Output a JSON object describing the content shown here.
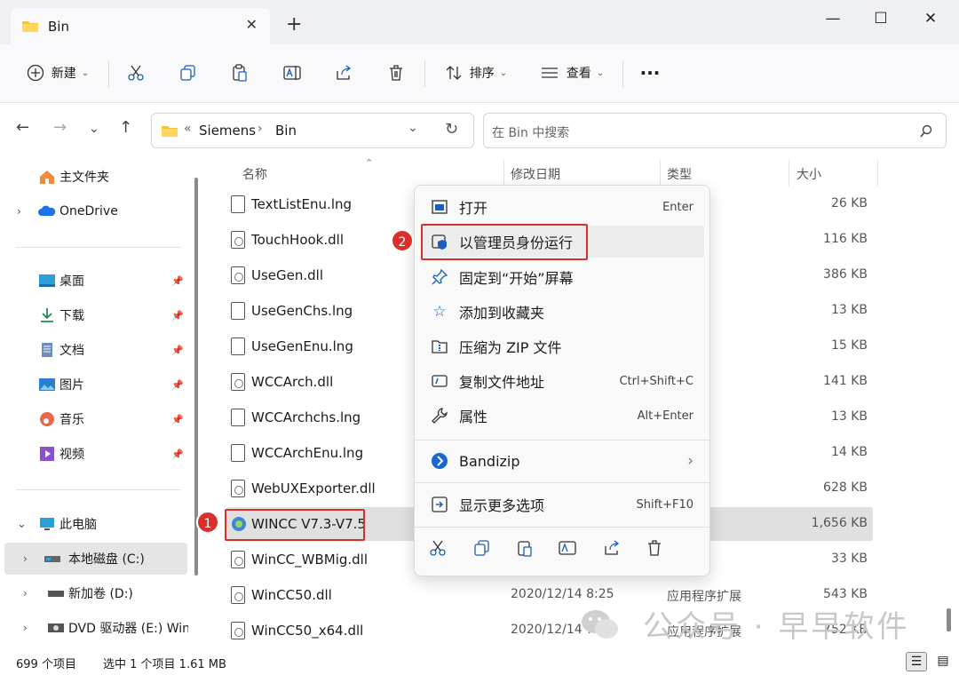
{
  "window": {
    "tab_title": "Bin",
    "close_tab": "✕",
    "new_tab": "+",
    "minimize": "—",
    "maximize": "☐",
    "close": "✕"
  },
  "toolbar": {
    "new_label": "新建",
    "sort_label": "排序",
    "view_label": "查看",
    "more_label": "···"
  },
  "navigation": {
    "breadcrumb_prefix": "«",
    "crumb_1": "Siemens",
    "crumb_sep": "›",
    "crumb_2": "Bin",
    "search_placeholder": "在 Bin 中搜索"
  },
  "sidebar": {
    "home": "主文件夹",
    "onedrive": "OneDrive",
    "desktop": "桌面",
    "downloads": "下载",
    "documents": "文档",
    "pictures": "图片",
    "music": "音乐",
    "videos": "视频",
    "this_pc": "此电脑",
    "drive_c": "本地磁盘 (C:)",
    "drive_d": "新加卷 (D:)",
    "drive_e": "DVD 驱动器 (E:) Win"
  },
  "columns": {
    "name": "名称",
    "date": "修改日期",
    "type": "类型",
    "size": "大小"
  },
  "files": [
    {
      "name": "TextListEnu.lng",
      "date": "",
      "type": "件",
      "size": "26 KB",
      "icon": "file"
    },
    {
      "name": "TouchHook.dll",
      "date": "",
      "type": "序扩展",
      "size": "116 KB",
      "icon": "dll"
    },
    {
      "name": "UseGen.dll",
      "date": "",
      "type": "序扩展",
      "size": "386 KB",
      "icon": "dll"
    },
    {
      "name": "UseGenChs.lng",
      "date": "",
      "type": "件",
      "size": "13 KB",
      "icon": "file"
    },
    {
      "name": "UseGenEnu.lng",
      "date": "",
      "type": "件",
      "size": "15 KB",
      "icon": "file"
    },
    {
      "name": "WCCArch.dll",
      "date": "",
      "type": "序扩展",
      "size": "141 KB",
      "icon": "dll"
    },
    {
      "name": "WCCArchchs.lng",
      "date": "",
      "type": "件",
      "size": "13 KB",
      "icon": "file"
    },
    {
      "name": "WCCArchEnu.lng",
      "date": "",
      "type": "件",
      "size": "14 KB",
      "icon": "file"
    },
    {
      "name": "WebUXExporter.dll",
      "date": "",
      "type": "序扩展",
      "size": "628 KB",
      "icon": "dll"
    },
    {
      "name": "WINCC V7.3-V7.5",
      "date": "",
      "type": "序",
      "size": "1,656 KB",
      "icon": "app"
    },
    {
      "name": "WinCC_WBMig.dll",
      "date": "",
      "type": "序扩展",
      "size": "33 KB",
      "icon": "dll"
    },
    {
      "name": "WinCC50.dll",
      "date": "2020/12/14 8:25",
      "type": "应用程序扩展",
      "size": "543 KB",
      "icon": "dll"
    },
    {
      "name": "WinCC50_x64.dll",
      "date": "2020/12/14 7:49",
      "type": "应用程序扩展",
      "size": "752 KB",
      "icon": "dll"
    }
  ],
  "context_menu": {
    "open": "打开",
    "open_shortcut": "Enter",
    "run_as_admin": "以管理员身份运行",
    "pin_start": "固定到“开始”屏幕",
    "add_favorites": "添加到收藏夹",
    "compress_zip": "压缩为 ZIP 文件",
    "copy_path": "复制文件地址",
    "copy_path_shortcut": "Ctrl+Shift+C",
    "properties": "属性",
    "properties_shortcut": "Alt+Enter",
    "bandizip": "Bandizip",
    "more_options": "显示更多选项",
    "more_options_shortcut": "Shift+F10"
  },
  "annotations": {
    "badge_1": "1",
    "badge_2": "2"
  },
  "status": {
    "item_count": "699 个项目",
    "selected": "选中 1 个项目 1.61 MB"
  },
  "watermark": "公众号 · 早早软件",
  "colors": {
    "accent": "#1c5fb8",
    "annotation_red": "#d9302c",
    "selection": "#e0e0e0"
  }
}
